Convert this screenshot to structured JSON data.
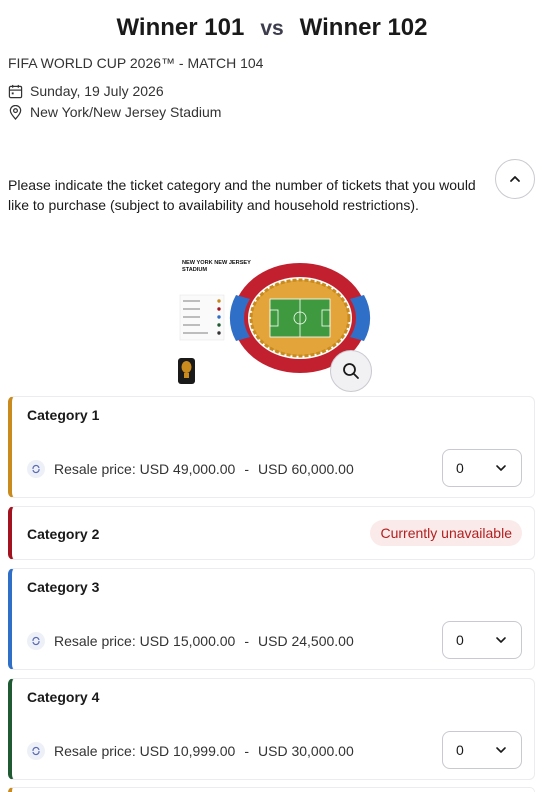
{
  "match": {
    "team_home": "Winner 101",
    "vs": "vs",
    "team_away": "Winner 102",
    "event": "FIFA WORLD CUP 2026™  - MATCH 104",
    "date": "Sunday, 19 July 2026",
    "venue": "New York/New Jersey Stadium"
  },
  "instructions": "Please indicate the ticket category and the number of tickets that you would like to purchase (subject to availability and household restrictions).",
  "map": {
    "title_line1": "NEW YORK NEW JERSEY",
    "title_line2": "STADIUM"
  },
  "colors": {
    "category_1": "#c98a1e",
    "category_2": "#a3121f",
    "category_3": "#2f6fc7",
    "category_4": "#1f5a33"
  },
  "categories": [
    {
      "name": "Category 1",
      "price_label": "Resale price:",
      "price_min": "USD 49,000.00",
      "separator": "-",
      "price_max": "USD 60,000.00",
      "quantity": "0"
    },
    {
      "name": "Category 2",
      "status": "Currently unavailable"
    },
    {
      "name": "Category 3",
      "price_label": "Resale price:",
      "price_min": "USD 15,000.00",
      "separator": "-",
      "price_max": "USD 24,500.00",
      "quantity": "0"
    },
    {
      "name": "Category 4",
      "price_label": "Resale price:",
      "price_min": "USD 10,999.00",
      "separator": "-",
      "price_max": "USD 30,000.00",
      "quantity": "0"
    }
  ]
}
